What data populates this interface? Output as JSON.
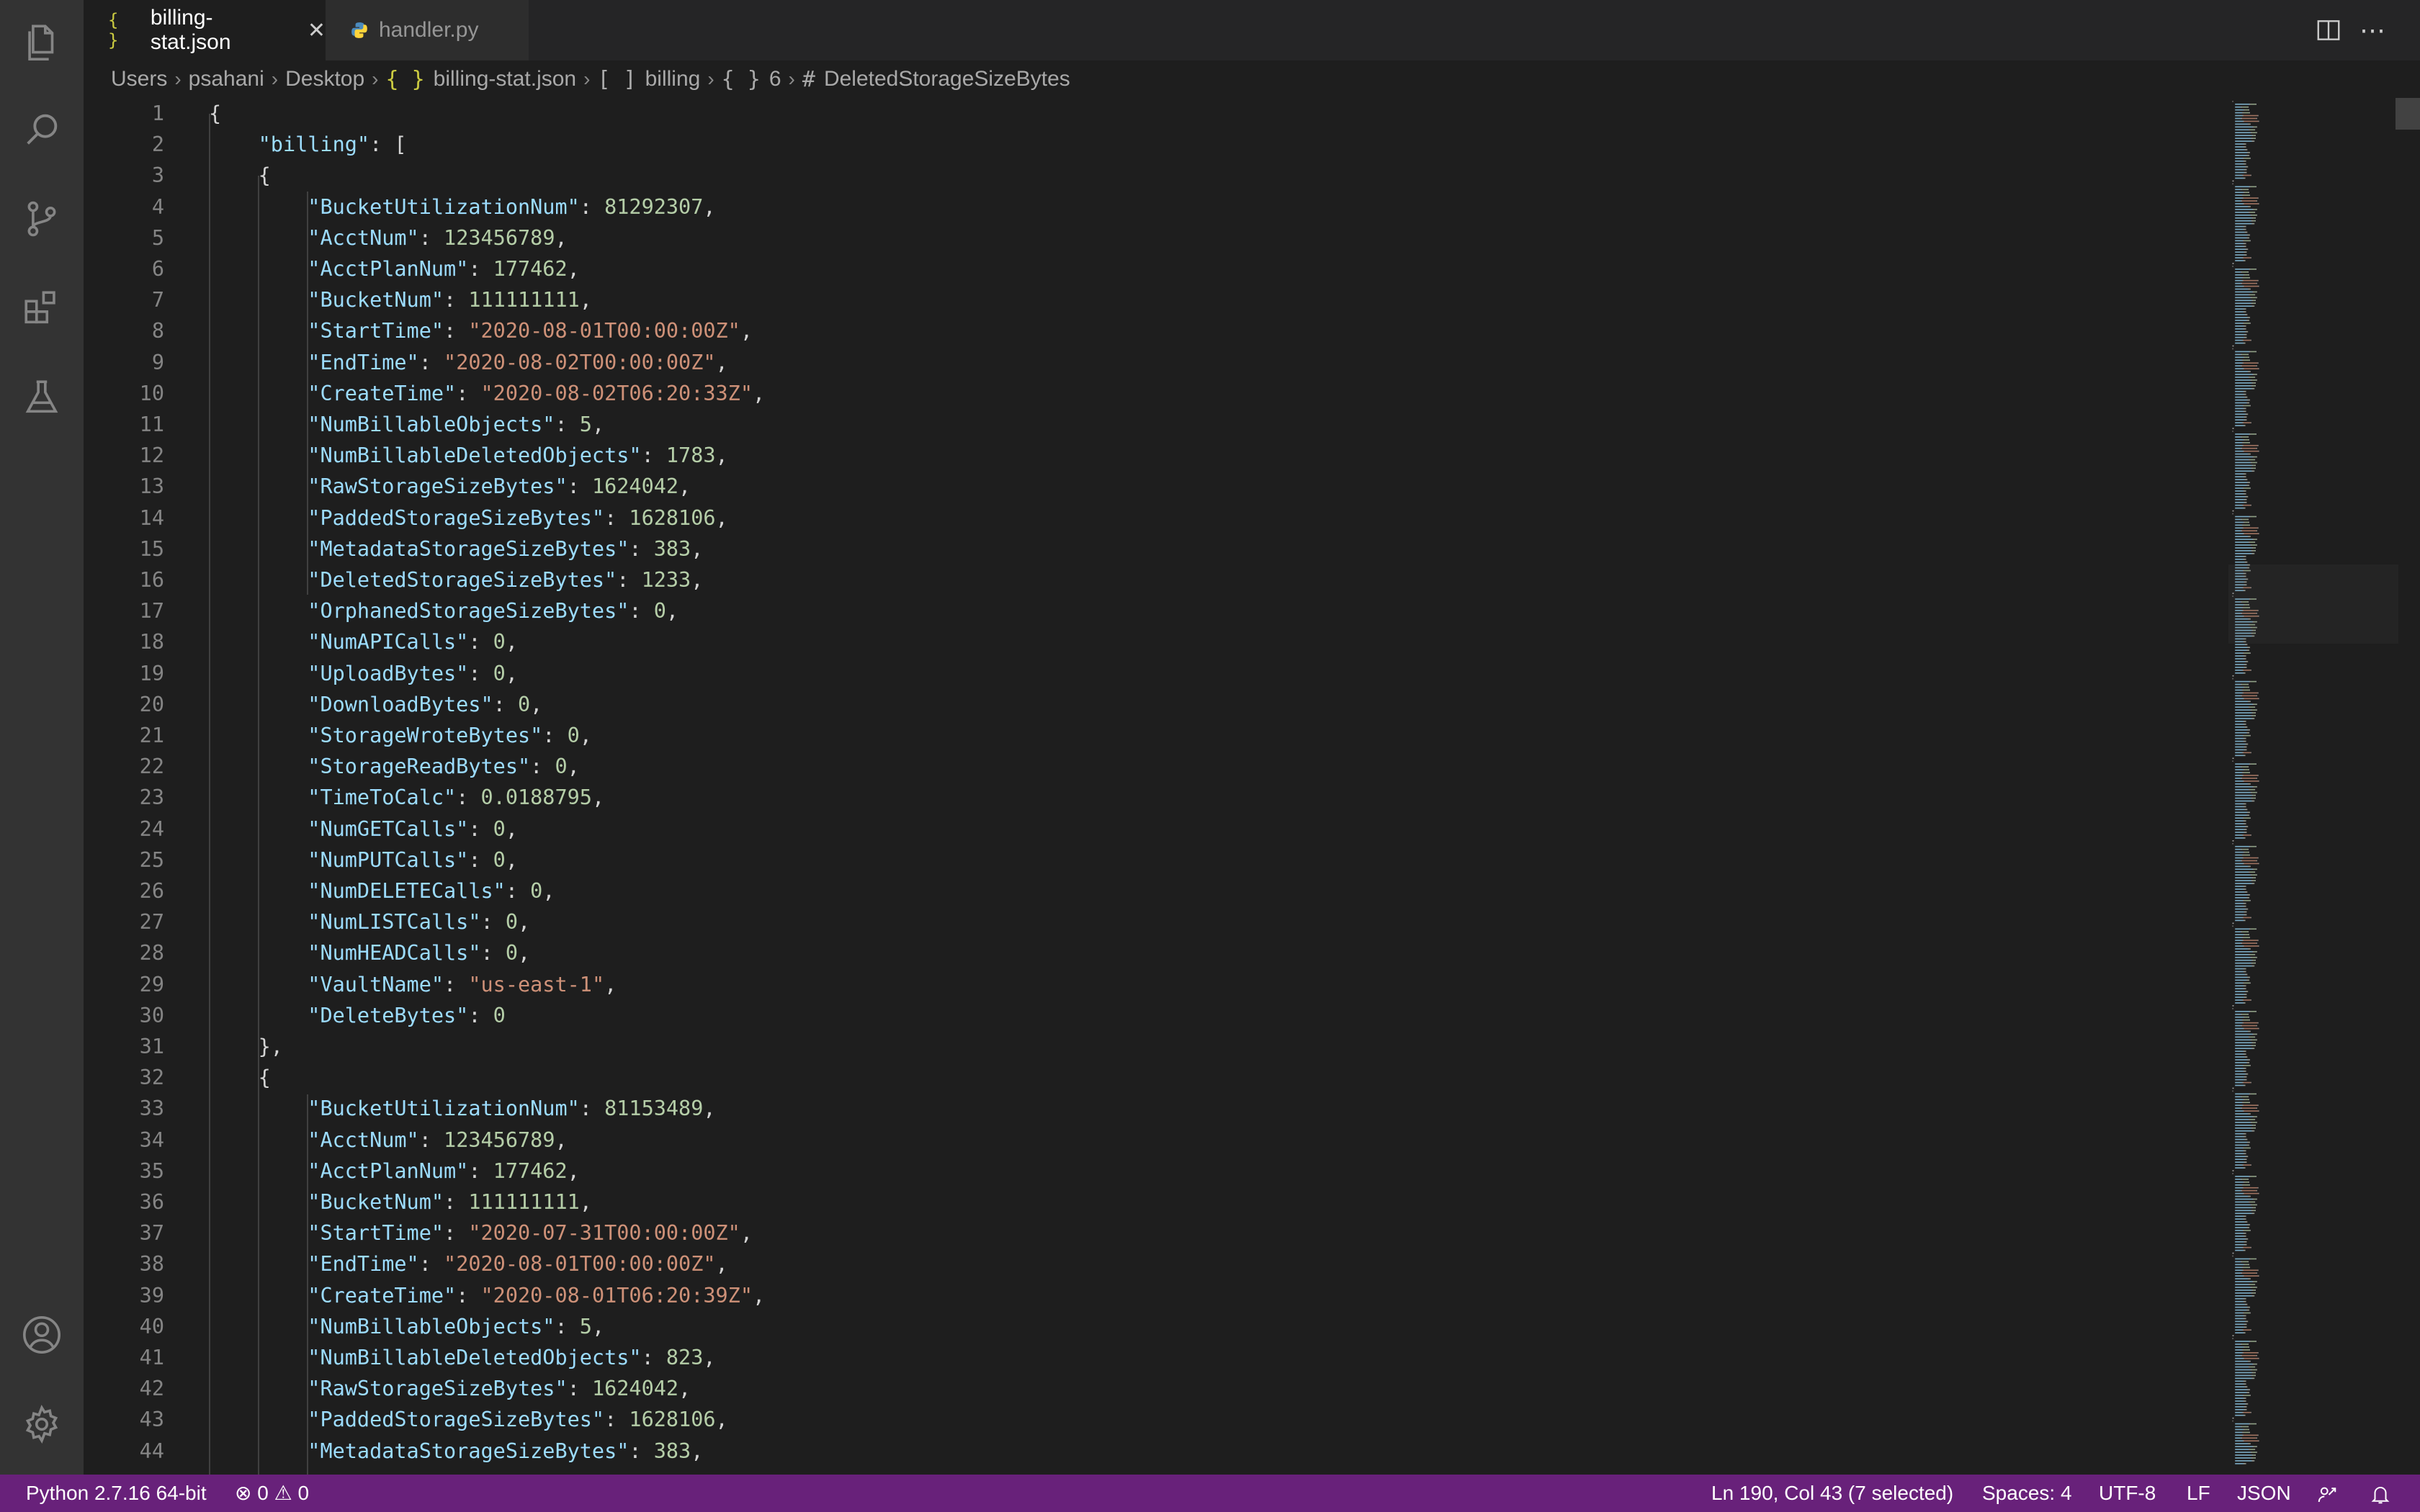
{
  "colors": {
    "key": "#9cdcfe",
    "string": "#ce9178",
    "number": "#b5cea8",
    "punct": "#d4d4d4",
    "statusbar": "#68217a",
    "activity_bar": "#333333",
    "editor_bg": "#1e1e1e"
  },
  "activity_bar": {
    "items": [
      {
        "name": "explorer-icon"
      },
      {
        "name": "search-icon"
      },
      {
        "name": "source-control-icon"
      },
      {
        "name": "extensions-icon"
      },
      {
        "name": "testing-icon"
      }
    ],
    "bottom": [
      {
        "name": "account-icon"
      },
      {
        "name": "settings-gear-icon"
      }
    ]
  },
  "tabs": [
    {
      "label": "billing-stat.json",
      "icon": "{ }",
      "active": true
    },
    {
      "label": "handler.py",
      "icon": "python-icon",
      "active": false
    }
  ],
  "breadcrumb": {
    "items": [
      "Users",
      "psahani",
      "Desktop",
      "billing-stat.json",
      "billing",
      "6",
      "DeletedStorageSizeBytes"
    ],
    "icons": [
      "",
      "",
      "",
      "{ }",
      "[ ]",
      "{ }",
      "#"
    ]
  },
  "editor": {
    "lines": [
      {
        "n": "1",
        "t": [
          [
            "p",
            "{"
          ]
        ]
      },
      {
        "n": "2",
        "t": [
          [
            "p",
            "    "
          ],
          [
            "k",
            "\"billing\""
          ],
          [
            "p",
            ": ["
          ]
        ]
      },
      {
        "n": "3",
        "t": [
          [
            "p",
            "    {"
          ]
        ]
      },
      {
        "n": "4",
        "t": [
          [
            "p",
            "        "
          ],
          [
            "k",
            "\"BucketUtilizationNum\""
          ],
          [
            "p",
            ": "
          ],
          [
            "n",
            "81292307"
          ],
          [
            "p",
            ","
          ]
        ]
      },
      {
        "n": "5",
        "t": [
          [
            "p",
            "        "
          ],
          [
            "k",
            "\"AcctNum\""
          ],
          [
            "p",
            ": "
          ],
          [
            "n",
            "123456789"
          ],
          [
            "p",
            ","
          ]
        ]
      },
      {
        "n": "6",
        "t": [
          [
            "p",
            "        "
          ],
          [
            "k",
            "\"AcctPlanNum\""
          ],
          [
            "p",
            ": "
          ],
          [
            "n",
            "177462"
          ],
          [
            "p",
            ","
          ]
        ]
      },
      {
        "n": "7",
        "t": [
          [
            "p",
            "        "
          ],
          [
            "k",
            "\"BucketNum\""
          ],
          [
            "p",
            ": "
          ],
          [
            "n",
            "111111111"
          ],
          [
            "p",
            ","
          ]
        ]
      },
      {
        "n": "8",
        "t": [
          [
            "p",
            "        "
          ],
          [
            "k",
            "\"StartTime\""
          ],
          [
            "p",
            ": "
          ],
          [
            "s",
            "\"2020-08-01T00:00:00Z\""
          ],
          [
            "p",
            ","
          ]
        ]
      },
      {
        "n": "9",
        "t": [
          [
            "p",
            "        "
          ],
          [
            "k",
            "\"EndTime\""
          ],
          [
            "p",
            ": "
          ],
          [
            "s",
            "\"2020-08-02T00:00:00Z\""
          ],
          [
            "p",
            ","
          ]
        ]
      },
      {
        "n": "10",
        "t": [
          [
            "p",
            "        "
          ],
          [
            "k",
            "\"CreateTime\""
          ],
          [
            "p",
            ": "
          ],
          [
            "s",
            "\"2020-08-02T06:20:33Z\""
          ],
          [
            "p",
            ","
          ]
        ]
      },
      {
        "n": "11",
        "t": [
          [
            "p",
            "        "
          ],
          [
            "k",
            "\"NumBillableObjects\""
          ],
          [
            "p",
            ": "
          ],
          [
            "n",
            "5"
          ],
          [
            "p",
            ","
          ]
        ]
      },
      {
        "n": "12",
        "t": [
          [
            "p",
            "        "
          ],
          [
            "k",
            "\"NumBillableDeletedObjects\""
          ],
          [
            "p",
            ": "
          ],
          [
            "n",
            "1783"
          ],
          [
            "p",
            ","
          ]
        ]
      },
      {
        "n": "13",
        "t": [
          [
            "p",
            "        "
          ],
          [
            "k",
            "\"RawStorageSizeBytes\""
          ],
          [
            "p",
            ": "
          ],
          [
            "n",
            "1624042"
          ],
          [
            "p",
            ","
          ]
        ]
      },
      {
        "n": "14",
        "t": [
          [
            "p",
            "        "
          ],
          [
            "k",
            "\"PaddedStorageSizeBytes\""
          ],
          [
            "p",
            ": "
          ],
          [
            "n",
            "1628106"
          ],
          [
            "p",
            ","
          ]
        ]
      },
      {
        "n": "15",
        "t": [
          [
            "p",
            "        "
          ],
          [
            "k",
            "\"MetadataStorageSizeBytes\""
          ],
          [
            "p",
            ": "
          ],
          [
            "n",
            "383"
          ],
          [
            "p",
            ","
          ]
        ]
      },
      {
        "n": "16",
        "t": [
          [
            "p",
            "        "
          ],
          [
            "k",
            "\"DeletedStorageSizeBytes\""
          ],
          [
            "p",
            ": "
          ],
          [
            "n",
            "1233"
          ],
          [
            "p",
            ","
          ]
        ]
      },
      {
        "n": "17",
        "t": [
          [
            "p",
            "        "
          ],
          [
            "k",
            "\"OrphanedStorageSizeBytes\""
          ],
          [
            "p",
            ": "
          ],
          [
            "n",
            "0"
          ],
          [
            "p",
            ","
          ]
        ]
      },
      {
        "n": "18",
        "t": [
          [
            "p",
            "        "
          ],
          [
            "k",
            "\"NumAPICalls\""
          ],
          [
            "p",
            ": "
          ],
          [
            "n",
            "0"
          ],
          [
            "p",
            ","
          ]
        ]
      },
      {
        "n": "19",
        "t": [
          [
            "p",
            "        "
          ],
          [
            "k",
            "\"UploadBytes\""
          ],
          [
            "p",
            ": "
          ],
          [
            "n",
            "0"
          ],
          [
            "p",
            ","
          ]
        ]
      },
      {
        "n": "20",
        "t": [
          [
            "p",
            "        "
          ],
          [
            "k",
            "\"DownloadBytes\""
          ],
          [
            "p",
            ": "
          ],
          [
            "n",
            "0"
          ],
          [
            "p",
            ","
          ]
        ]
      },
      {
        "n": "21",
        "t": [
          [
            "p",
            "        "
          ],
          [
            "k",
            "\"StorageWroteBytes\""
          ],
          [
            "p",
            ": "
          ],
          [
            "n",
            "0"
          ],
          [
            "p",
            ","
          ]
        ]
      },
      {
        "n": "22",
        "t": [
          [
            "p",
            "        "
          ],
          [
            "k",
            "\"StorageReadBytes\""
          ],
          [
            "p",
            ": "
          ],
          [
            "n",
            "0"
          ],
          [
            "p",
            ","
          ]
        ]
      },
      {
        "n": "23",
        "t": [
          [
            "p",
            "        "
          ],
          [
            "k",
            "\"TimeToCalc\""
          ],
          [
            "p",
            ": "
          ],
          [
            "n",
            "0.0188795"
          ],
          [
            "p",
            ","
          ]
        ]
      },
      {
        "n": "24",
        "t": [
          [
            "p",
            "        "
          ],
          [
            "k",
            "\"NumGETCalls\""
          ],
          [
            "p",
            ": "
          ],
          [
            "n",
            "0"
          ],
          [
            "p",
            ","
          ]
        ]
      },
      {
        "n": "25",
        "t": [
          [
            "p",
            "        "
          ],
          [
            "k",
            "\"NumPUTCalls\""
          ],
          [
            "p",
            ": "
          ],
          [
            "n",
            "0"
          ],
          [
            "p",
            ","
          ]
        ]
      },
      {
        "n": "26",
        "t": [
          [
            "p",
            "        "
          ],
          [
            "k",
            "\"NumDELETECalls\""
          ],
          [
            "p",
            ": "
          ],
          [
            "n",
            "0"
          ],
          [
            "p",
            ","
          ]
        ]
      },
      {
        "n": "27",
        "t": [
          [
            "p",
            "        "
          ],
          [
            "k",
            "\"NumLISTCalls\""
          ],
          [
            "p",
            ": "
          ],
          [
            "n",
            "0"
          ],
          [
            "p",
            ","
          ]
        ]
      },
      {
        "n": "28",
        "t": [
          [
            "p",
            "        "
          ],
          [
            "k",
            "\"NumHEADCalls\""
          ],
          [
            "p",
            ": "
          ],
          [
            "n",
            "0"
          ],
          [
            "p",
            ","
          ]
        ]
      },
      {
        "n": "29",
        "t": [
          [
            "p",
            "        "
          ],
          [
            "k",
            "\"VaultName\""
          ],
          [
            "p",
            ": "
          ],
          [
            "s",
            "\"us-east-1\""
          ],
          [
            "p",
            ","
          ]
        ]
      },
      {
        "n": "30",
        "t": [
          [
            "p",
            "        "
          ],
          [
            "k",
            "\"DeleteBytes\""
          ],
          [
            "p",
            ": "
          ],
          [
            "n",
            "0"
          ]
        ]
      },
      {
        "n": "31",
        "t": [
          [
            "p",
            "    },"
          ]
        ]
      },
      {
        "n": "32",
        "t": [
          [
            "p",
            "    {"
          ]
        ]
      },
      {
        "n": "33",
        "t": [
          [
            "p",
            "        "
          ],
          [
            "k",
            "\"BucketUtilizationNum\""
          ],
          [
            "p",
            ": "
          ],
          [
            "n",
            "81153489"
          ],
          [
            "p",
            ","
          ]
        ]
      },
      {
        "n": "34",
        "t": [
          [
            "p",
            "        "
          ],
          [
            "k",
            "\"AcctNum\""
          ],
          [
            "p",
            ": "
          ],
          [
            "n",
            "123456789"
          ],
          [
            "p",
            ","
          ]
        ]
      },
      {
        "n": "35",
        "t": [
          [
            "p",
            "        "
          ],
          [
            "k",
            "\"AcctPlanNum\""
          ],
          [
            "p",
            ": "
          ],
          [
            "n",
            "177462"
          ],
          [
            "p",
            ","
          ]
        ]
      },
      {
        "n": "36",
        "t": [
          [
            "p",
            "        "
          ],
          [
            "k",
            "\"BucketNum\""
          ],
          [
            "p",
            ": "
          ],
          [
            "n",
            "111111111"
          ],
          [
            "p",
            ","
          ]
        ]
      },
      {
        "n": "37",
        "t": [
          [
            "p",
            "        "
          ],
          [
            "k",
            "\"StartTime\""
          ],
          [
            "p",
            ": "
          ],
          [
            "s",
            "\"2020-07-31T00:00:00Z\""
          ],
          [
            "p",
            ","
          ]
        ]
      },
      {
        "n": "38",
        "t": [
          [
            "p",
            "        "
          ],
          [
            "k",
            "\"EndTime\""
          ],
          [
            "p",
            ": "
          ],
          [
            "s",
            "\"2020-08-01T00:00:00Z\""
          ],
          [
            "p",
            ","
          ]
        ]
      },
      {
        "n": "39",
        "t": [
          [
            "p",
            "        "
          ],
          [
            "k",
            "\"CreateTime\""
          ],
          [
            "p",
            ": "
          ],
          [
            "s",
            "\"2020-08-01T06:20:39Z\""
          ],
          [
            "p",
            ","
          ]
        ]
      },
      {
        "n": "40",
        "t": [
          [
            "p",
            "        "
          ],
          [
            "k",
            "\"NumBillableObjects\""
          ],
          [
            "p",
            ": "
          ],
          [
            "n",
            "5"
          ],
          [
            "p",
            ","
          ]
        ]
      },
      {
        "n": "41",
        "t": [
          [
            "p",
            "        "
          ],
          [
            "k",
            "\"NumBillableDeletedObjects\""
          ],
          [
            "p",
            ": "
          ],
          [
            "n",
            "823"
          ],
          [
            "p",
            ","
          ]
        ]
      },
      {
        "n": "42",
        "t": [
          [
            "p",
            "        "
          ],
          [
            "k",
            "\"RawStorageSizeBytes\""
          ],
          [
            "p",
            ": "
          ],
          [
            "n",
            "1624042"
          ],
          [
            "p",
            ","
          ]
        ]
      },
      {
        "n": "43",
        "t": [
          [
            "p",
            "        "
          ],
          [
            "k",
            "\"PaddedStorageSizeBytes\""
          ],
          [
            "p",
            ": "
          ],
          [
            "n",
            "1628106"
          ],
          [
            "p",
            ","
          ]
        ]
      },
      {
        "n": "44",
        "t": [
          [
            "p",
            "        "
          ],
          [
            "k",
            "\"MetadataStorageSizeBytes\""
          ],
          [
            "p",
            ": "
          ],
          [
            "n",
            "383"
          ],
          [
            "p",
            ","
          ]
        ]
      }
    ]
  },
  "statusbar": {
    "interpreter": "Python 2.7.16 64-bit",
    "errors": "0",
    "warnings": "0",
    "cursor": "Ln 190, Col 43 (7 selected)",
    "indent": "Spaces: 4",
    "encoding": "UTF-8",
    "eol": "LF",
    "language": "JSON"
  }
}
